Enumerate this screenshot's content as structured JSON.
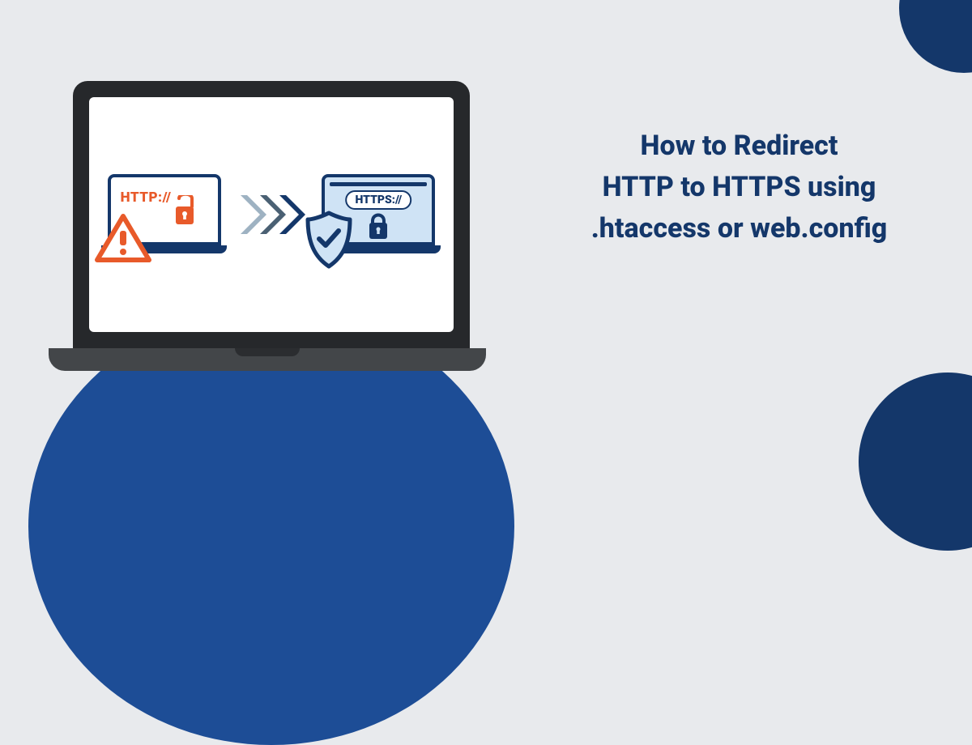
{
  "title": {
    "line1": "How to Redirect",
    "line2": "HTTP to HTTPS using",
    "line3": ".htaccess or web.config"
  },
  "screen": {
    "http_label": "HTTP://",
    "https_label": "HTTPS://"
  },
  "colors": {
    "brand_dark": "#14376a",
    "brand_mid": "#1d4d96",
    "accent_orange": "#e85a2a",
    "slate": "#4a6073",
    "light_blue": "#cfe3f5"
  }
}
